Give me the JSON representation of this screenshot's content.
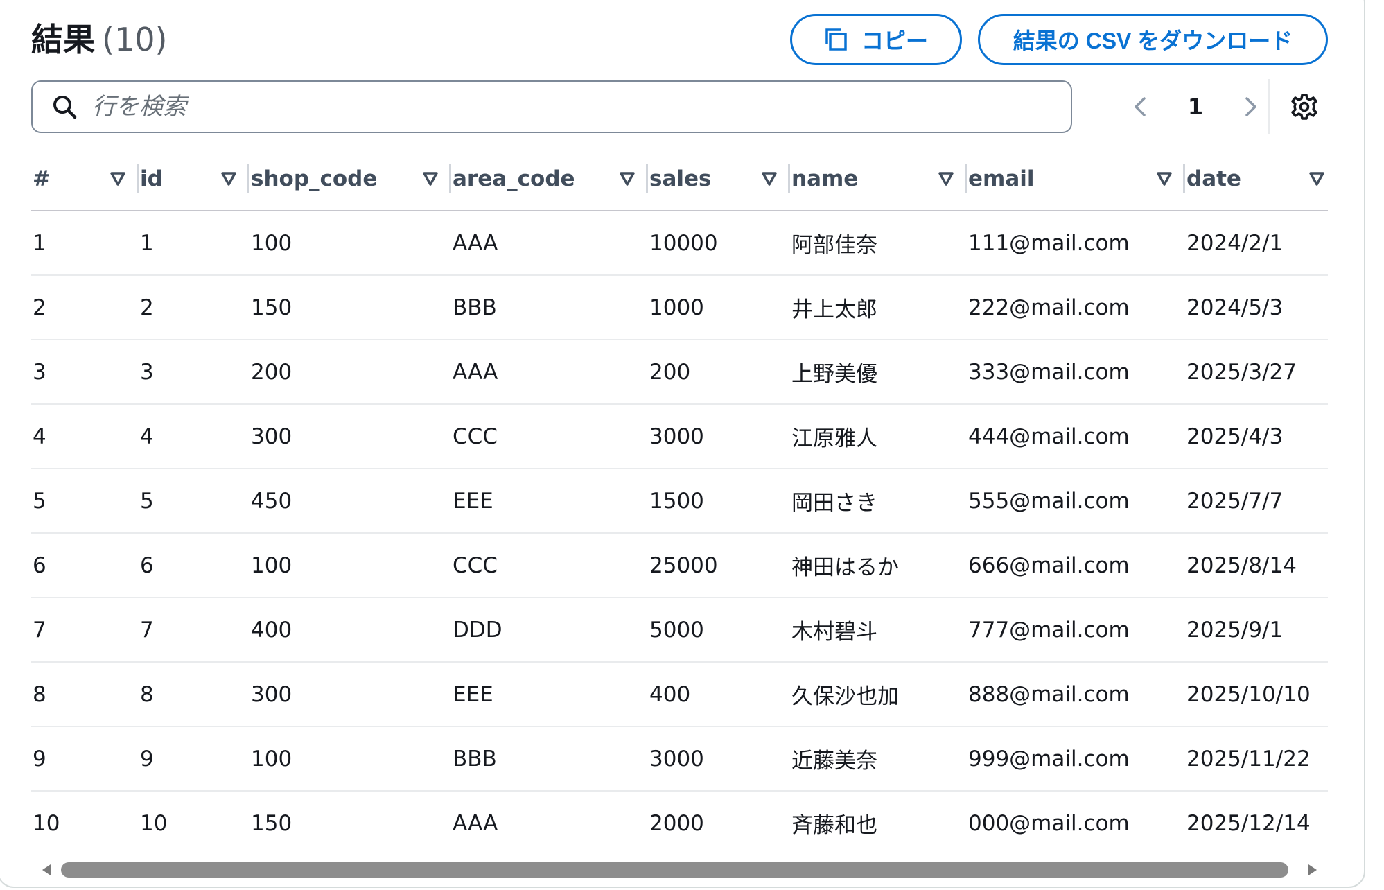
{
  "header": {
    "title": "結果",
    "count": "(10)",
    "copy_label": "コピー",
    "download_label": "結果の CSV をダウンロード"
  },
  "search": {
    "placeholder": "行を検索",
    "value": ""
  },
  "pagination": {
    "current_page": "1"
  },
  "icons": {
    "copy": "copy-icon",
    "search": "search-icon",
    "prev": "chevron-left-icon",
    "next": "chevron-right-icon",
    "settings": "gear-icon",
    "sort": "caret-down-icon"
  },
  "colors": {
    "accent": "#0972d3",
    "text": "#16191f",
    "header_text": "#414d5c",
    "muted": "#687078"
  },
  "table": {
    "columns": [
      "#",
      "id",
      "shop_code",
      "area_code",
      "sales",
      "name",
      "email",
      "date"
    ],
    "rows": [
      [
        "1",
        "1",
        "100",
        "AAA",
        "10000",
        "阿部佳奈",
        "111@mail.com",
        "2024/2/1"
      ],
      [
        "2",
        "2",
        "150",
        "BBB",
        "1000",
        "井上太郎",
        "222@mail.com",
        "2024/5/3"
      ],
      [
        "3",
        "3",
        "200",
        "AAA",
        "200",
        "上野美優",
        "333@mail.com",
        "2025/3/27"
      ],
      [
        "4",
        "4",
        "300",
        "CCC",
        "3000",
        "江原雅人",
        "444@mail.com",
        "2025/4/3"
      ],
      [
        "5",
        "5",
        "450",
        "EEE",
        "1500",
        "岡田さき",
        "555@mail.com",
        "2025/7/7"
      ],
      [
        "6",
        "6",
        "100",
        "CCC",
        "25000",
        "神田はるか",
        "666@mail.com",
        "2025/8/14"
      ],
      [
        "7",
        "7",
        "400",
        "DDD",
        "5000",
        "木村碧斗",
        "777@mail.com",
        "2025/9/1"
      ],
      [
        "8",
        "8",
        "300",
        "EEE",
        "400",
        "久保沙也加",
        "888@mail.com",
        "2025/10/10"
      ],
      [
        "9",
        "9",
        "100",
        "BBB",
        "3000",
        "近藤美奈",
        "999@mail.com",
        "2025/11/22"
      ],
      [
        "10",
        "10",
        "150",
        "AAA",
        "2000",
        "斉藤和也",
        "000@mail.com",
        "2025/12/14"
      ]
    ]
  }
}
